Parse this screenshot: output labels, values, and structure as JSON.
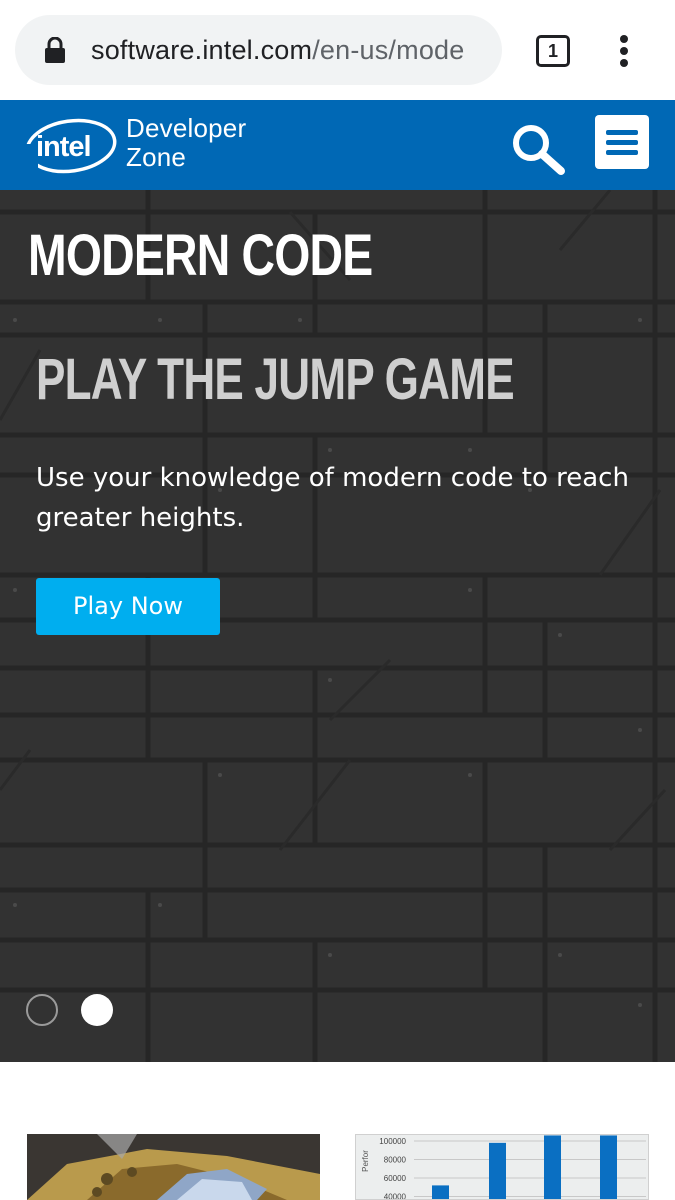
{
  "browser": {
    "url_host": "software.intel.com",
    "url_path": "/en-us/mode",
    "tab_count": "1"
  },
  "header": {
    "logo_text": "intel",
    "brand_line1": "Developer",
    "brand_line2": "Zone",
    "brand_color": "#0068b5"
  },
  "hero": {
    "eyebrow": "MODERN CODE",
    "title": "PLAY THE JUMP GAME",
    "description": "Use your knowledge of modern code to reach greater heights.",
    "button_label": "Play Now",
    "button_color": "#00aeef",
    "carousel": {
      "slides": 2,
      "active": 2
    }
  },
  "thumbnails": [
    {
      "kind": "photo"
    },
    {
      "kind": "chart",
      "chart_data": {
        "type": "bar",
        "ylabel": "Perfor",
        "ytick_labels": [
          "100000",
          "80000",
          "60000",
          "40000"
        ],
        "values": [
          52000,
          98000,
          106000,
          106000
        ]
      }
    }
  ],
  "icons": [
    "lock-icon",
    "tabs-icon",
    "overflow-menu-icon",
    "intel-logo",
    "search-icon",
    "hamburger-menu-icon"
  ]
}
